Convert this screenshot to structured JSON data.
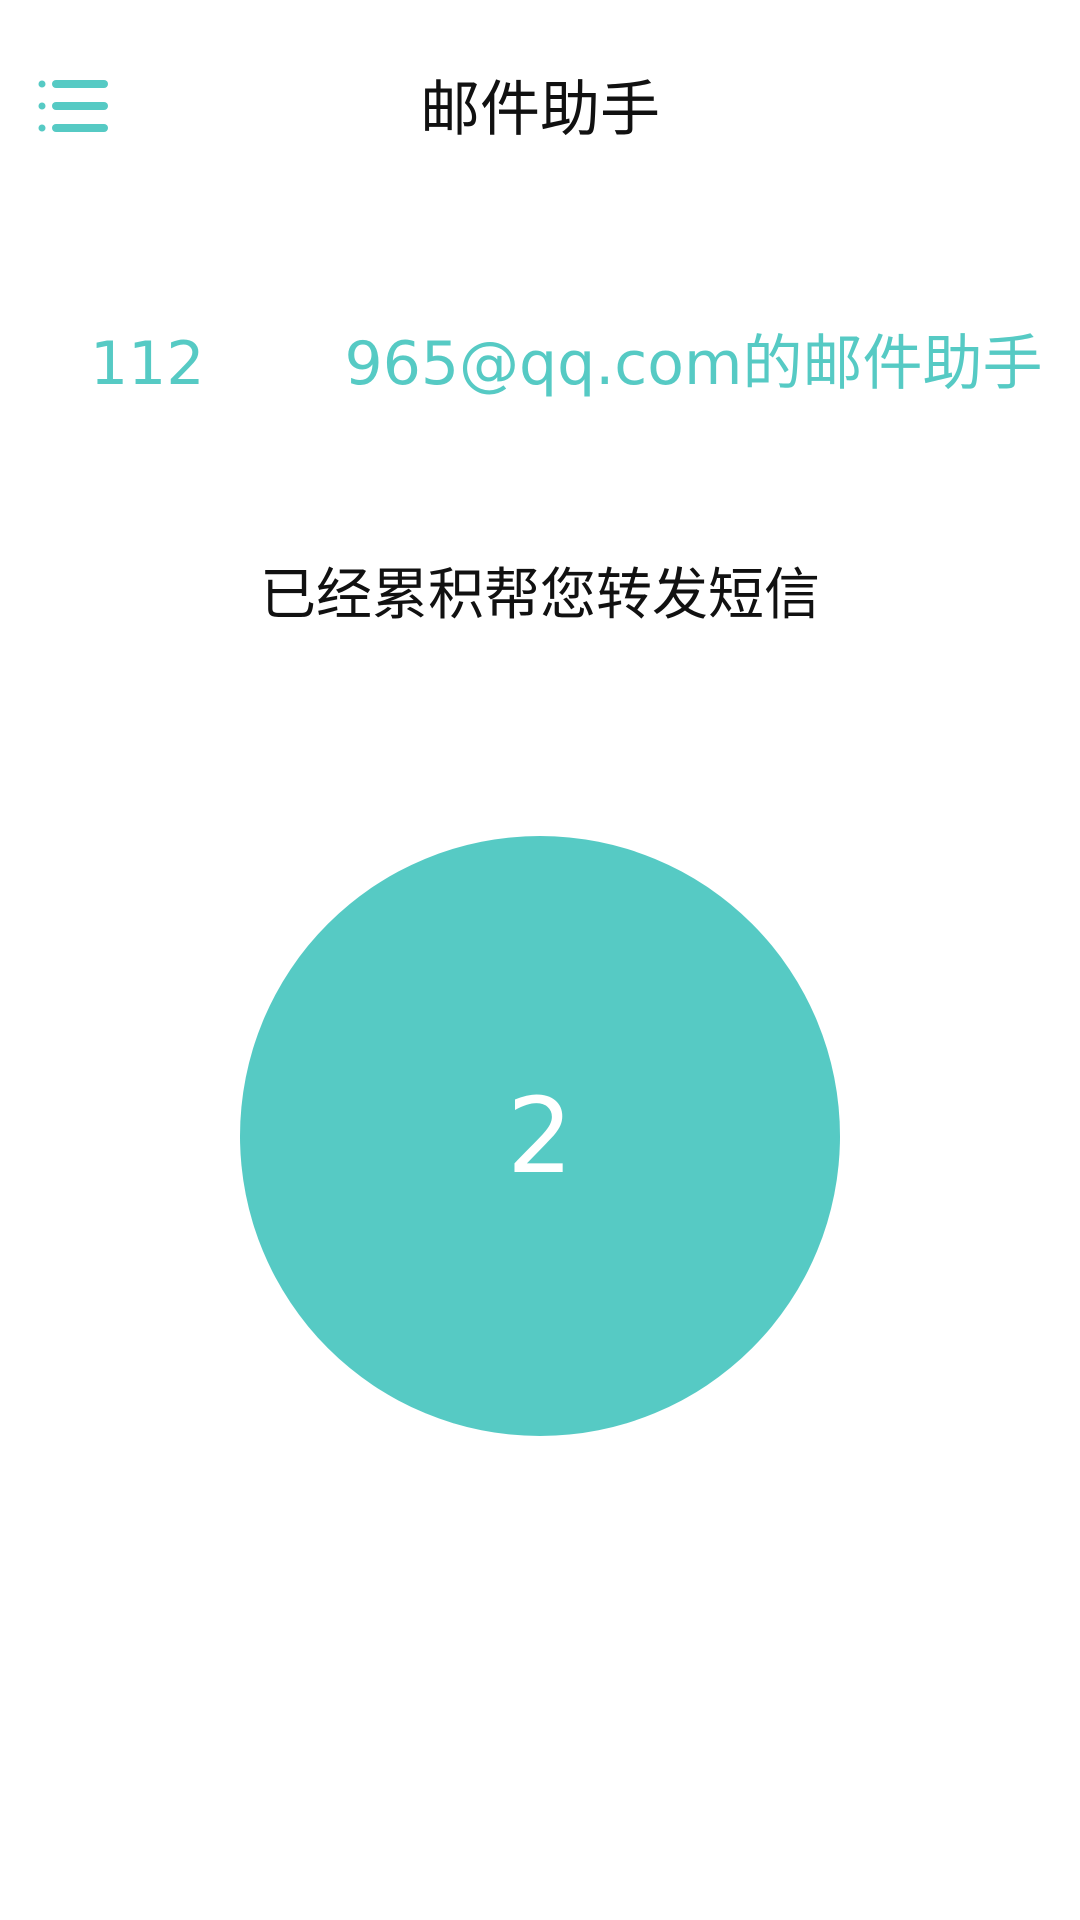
{
  "header": {
    "title": "邮件助手",
    "menu_icon": "menu-list-icon"
  },
  "account": {
    "prefix": "112",
    "suffix": "965@qq.com的邮件助手"
  },
  "stats": {
    "label": "已经累积帮您转发短信",
    "count": "2"
  },
  "colors": {
    "accent": "#56cac4",
    "title_text": "#111111",
    "background": "#ffffff",
    "circle_text": "#ffffff"
  }
}
